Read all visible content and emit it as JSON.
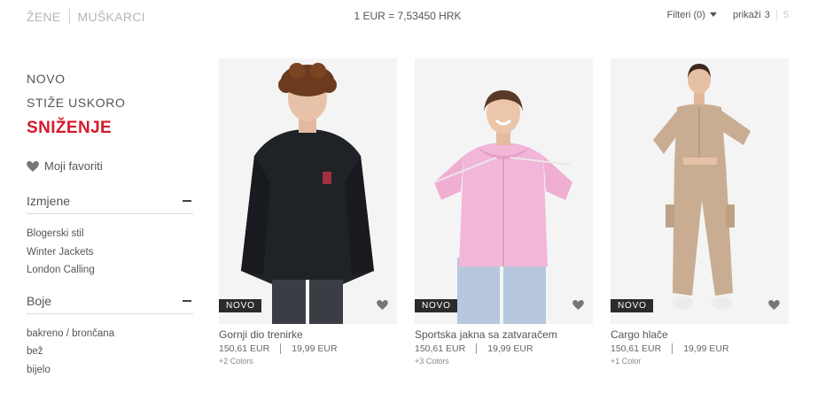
{
  "header": {
    "gender_women": "ŽENE",
    "gender_men": "MUŠKARCI",
    "currency_rate": "1 EUR = 7,53450 HRK",
    "filters_label": "Filteri (0)",
    "show_label": "prikaži",
    "show_option_active": "3",
    "show_option_other": "5"
  },
  "sidebar": {
    "nav_new": "NOVO",
    "nav_coming": "STIŽE USKORO",
    "nav_sale": "SNIŽENJE",
    "favorites": "Moji favoriti",
    "sections": [
      {
        "title": "Izmjene",
        "items": [
          "Blogerski stil",
          "Winter Jackets",
          "London Calling"
        ]
      },
      {
        "title": "Boje",
        "items": [
          "bakreno / brončana",
          "bež",
          "bijelo"
        ]
      }
    ]
  },
  "products": [
    {
      "badge": "NOVO",
      "name": "Gornji dio trenirke",
      "price_eur": "150,61 EUR",
      "price_eur2": "19,99 EUR",
      "colors": "+2 Colors"
    },
    {
      "badge": "NOVO",
      "name": "Sportska jakna sa zatvaračem",
      "price_eur": "150,61 EUR",
      "price_eur2": "19,99 EUR",
      "colors": "+3 Colors"
    },
    {
      "badge": "NOVO",
      "name": "Cargo hlače",
      "price_eur": "150,61 EUR",
      "price_eur2": "19,99 EUR",
      "colors": "+1 Color"
    }
  ],
  "colors": {
    "sale": "#d5192b",
    "badge_bg": "#2b2b2b",
    "heart": "#777777"
  }
}
